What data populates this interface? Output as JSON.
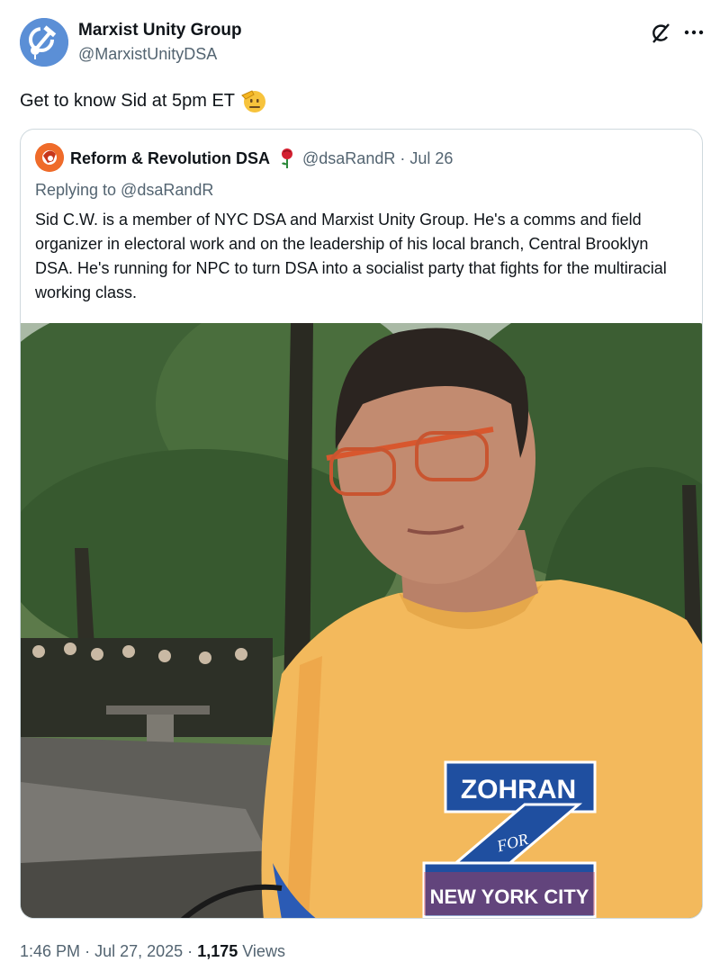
{
  "author": {
    "name": "Marxist Unity Group",
    "handle": "@MarxistUnityDSA",
    "avatar_icon": "hammer-sickle-rose-icon"
  },
  "tweet": {
    "text": "Get to know Sid at 5pm ET",
    "emoji": "saluting-face-emoji"
  },
  "quote": {
    "name": "Reform & Revolution DSA",
    "name_emoji": "rose-emoji",
    "handle": "@dsaRandR",
    "separator": "·",
    "date": "Jul 26",
    "replying_to": "Replying to @dsaRandR",
    "text": "Sid C.W. is a member of NYC DSA and Marxist Unity Group. He's a comms and field organizer in electoral work and on the leadership of his local branch, Central Brooklyn DSA. He's running for NPC to turn DSA into a socialist party that fights for the multiracial working class.",
    "shirt_line1": "ZOHRAN",
    "shirt_line2": "FOR",
    "shirt_line3": "NEW YORK CITY",
    "shirt_letter": "Z"
  },
  "meta": {
    "time": "1:46 PM",
    "separator": "·",
    "date": "Jul 27, 2025",
    "views_count": "1,175",
    "views_label": "Views"
  },
  "colors": {
    "accent": "#1d9bf0",
    "secondary_text": "#536471",
    "shirt": "#f3b95c",
    "z_red": "#e0303a",
    "z_blue": "#1f4fa0"
  }
}
